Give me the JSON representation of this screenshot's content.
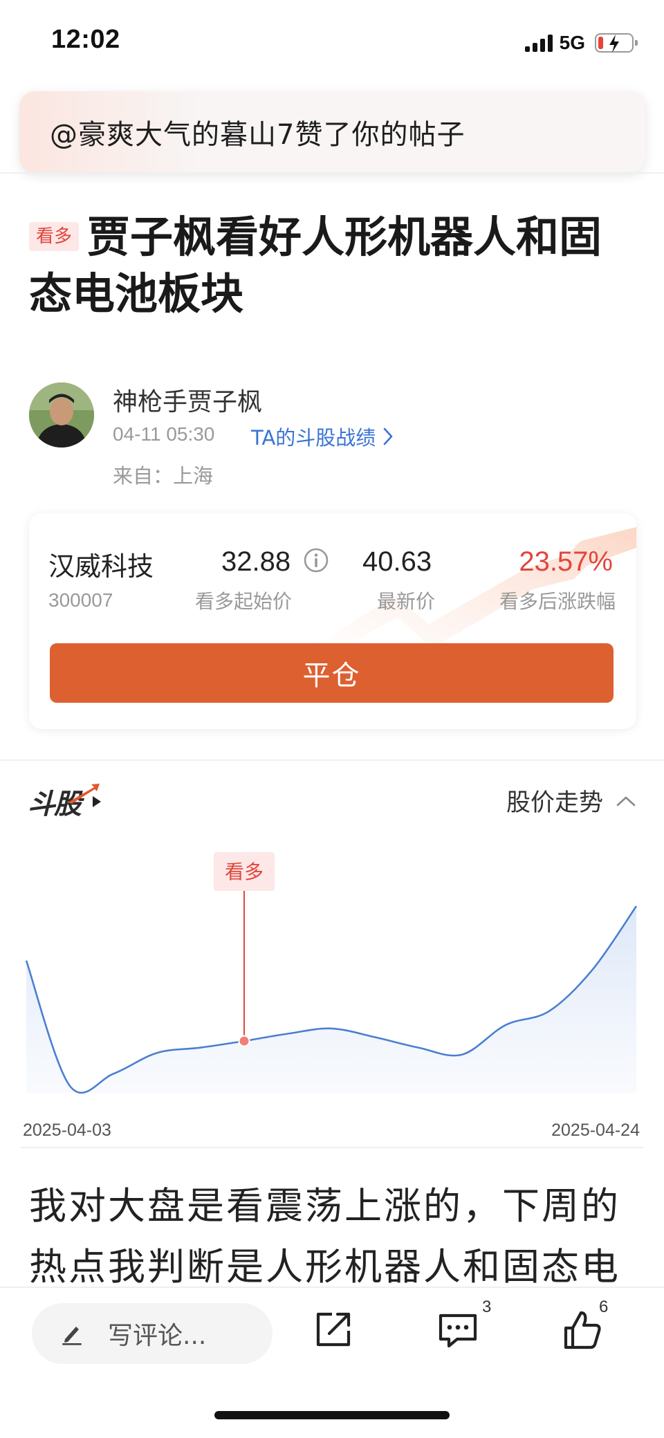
{
  "status_bar": {
    "time": "12:02",
    "network": "5G"
  },
  "notification": {
    "text": "@豪爽大气的暮山7赞了你的帖子"
  },
  "post": {
    "tag": "看多",
    "title": "贾子枫看好人形机器人和固态电池板块",
    "author": "神枪手贾子枫",
    "time": "04-11 05:30",
    "record_link": "TA的斗股战绩",
    "location": "来自：上海",
    "body": "我对大盘是看震荡上涨的，下周的热点我判断是人形机器人和固态电"
  },
  "stock_card": {
    "name": "汉威科技",
    "code": "300007",
    "start_price": "32.88",
    "start_price_label": "看多起始价",
    "latest_price": "40.63",
    "latest_price_label": "最新价",
    "change": "23.57%",
    "change_label": "看多后涨跌幅",
    "close_button": "平仓",
    "change_color": "#e2453c"
  },
  "chart_section": {
    "brand": "斗股",
    "toggle_label": "股价走势",
    "marker_label": "看多",
    "start_date": "2025-04-03",
    "end_date": "2025-04-24"
  },
  "chart_data": {
    "type": "area",
    "x": [
      "2025-04-03",
      "2025-04-07",
      "2025-04-08",
      "2025-04-09",
      "2025-04-10",
      "2025-04-11",
      "2025-04-14",
      "2025-04-15",
      "2025-04-16",
      "2025-04-17",
      "2025-04-18",
      "2025-04-21",
      "2025-04-22",
      "2025-04-23",
      "2025-04-24"
    ],
    "values": [
      37.5,
      30.3,
      31.0,
      32.2,
      32.5,
      32.88,
      33.3,
      33.6,
      33.1,
      32.5,
      32.1,
      33.8,
      34.6,
      37.0,
      40.63
    ],
    "marker": {
      "x": "2025-04-11",
      "label": "看多"
    },
    "line_color": "#4a7fd0"
  },
  "bottom_bar": {
    "comment_placeholder": "写评论...",
    "comment_count": "3",
    "like_count": "6"
  }
}
